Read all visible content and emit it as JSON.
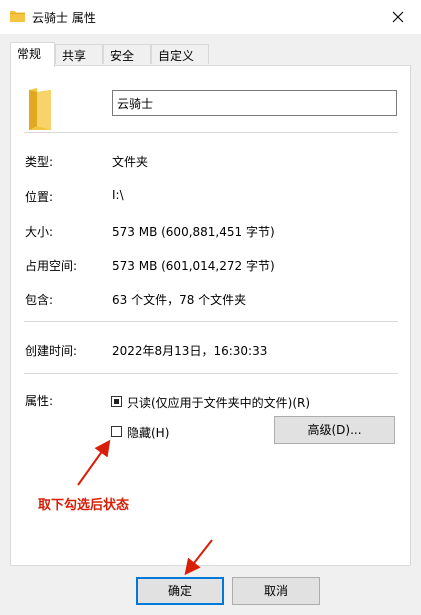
{
  "window": {
    "title": "云骑士 属性"
  },
  "tabs": [
    {
      "label": "常规",
      "active": true
    },
    {
      "label": "共享",
      "active": false
    },
    {
      "label": "安全",
      "active": false
    },
    {
      "label": "自定义",
      "active": false
    }
  ],
  "general": {
    "name": "云骑士",
    "type_label": "类型:",
    "type_value": "文件夹",
    "location_label": "位置:",
    "location_value": "I:\\",
    "size_label": "大小:",
    "size_value": "573 MB (600,881,451 字节)",
    "disk_size_label": "占用空间:",
    "disk_size_value": "573 MB (601,014,272 字节)",
    "contains_label": "包含:",
    "contains_value": "63 个文件，78 个文件夹",
    "created_label": "创建时间:",
    "created_value": "2022年8月13日，16:30:33",
    "attributes_label": "属性:",
    "readonly_label": "只读(仅应用于文件夹中的文件)(R)",
    "readonly_state": "indeterminate",
    "hidden_label": "隐藏(H)",
    "hidden_checked": false,
    "advanced_button": "高级(D)..."
  },
  "annotation": {
    "text": "取下勾选后状态",
    "color": "#d81e06"
  },
  "footer": {
    "ok_button": "确定",
    "cancel_button": "取消"
  },
  "colors": {
    "folder": "#f4c542",
    "accent": "#0078d7"
  }
}
